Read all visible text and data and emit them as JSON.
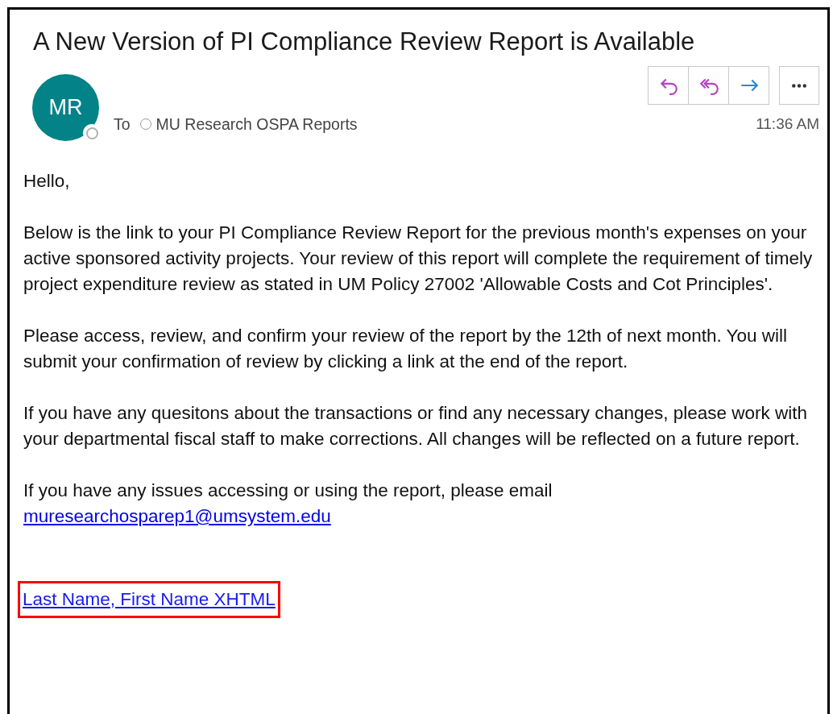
{
  "subject": "A New Version of PI Compliance Review Report is Available",
  "sender": {
    "initials": "MR",
    "to_label": "To",
    "recipient": "MU Research OSPA Reports",
    "time": "11:36 AM"
  },
  "actions": [
    {
      "kind": "reply"
    },
    {
      "kind": "reply_all"
    },
    {
      "kind": "forward"
    },
    {
      "kind": "more"
    }
  ],
  "body": [
    {
      "text": "Hello,"
    },
    {
      "text": "Below is the link to your PI Compliance Review Report for the previous month's expenses on your active sponsored activity projects. Your review of this report will complete the requirement of timely project expenditure review as stated in UM Policy 27002 'Allowable Costs and Cot Principles'."
    },
    {
      "text": "Please access, review, and confirm your review of the report by the 12th of next month. You will submit your confirmation of review by clicking a link at the end of the report."
    },
    {
      "text": "If you have any quesitons about the transactions or find any necessary changes, please work with your departmental fiscal staff to make corrections. All changes will be reflected on a future report."
    },
    {
      "text": "If you have any issues accessing or using the report, please email",
      "link": "muresearchosparep1@umsystem.edu"
    }
  ],
  "report_link": {
    "text": "Last Name, First Name XHTML",
    "highlighted": true
  }
}
